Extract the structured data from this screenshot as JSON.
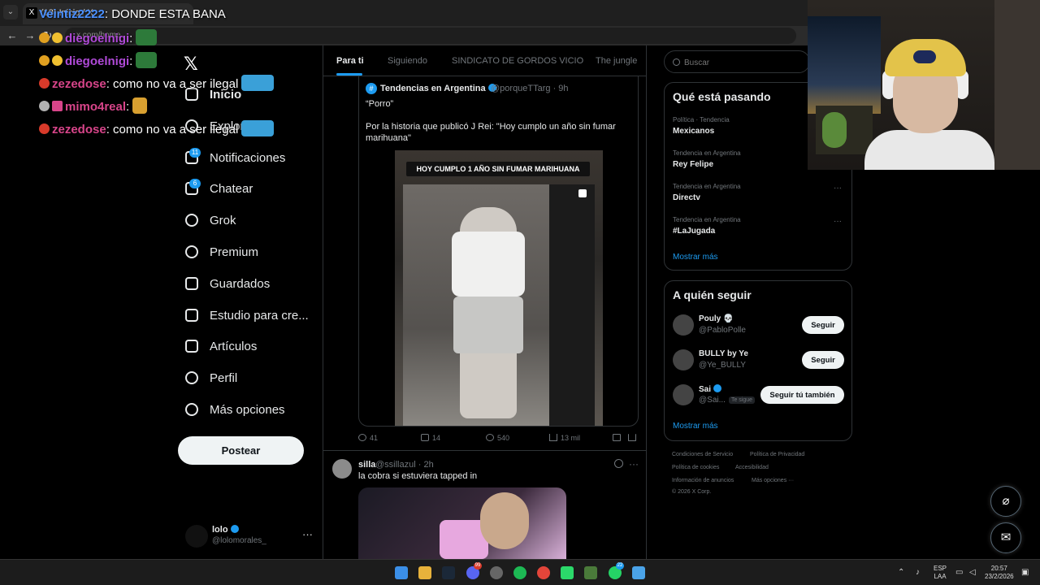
{
  "browser": {
    "tab_title": "(13) Inicio / X",
    "tab_menu_glyph": "⌄",
    "url_text": "x.com/home"
  },
  "chat": [
    {
      "user": "Veintiz2222",
      "message": ": DONDE ESTA BANA",
      "user_color": "#4a90ff"
    },
    {
      "user": "diegoelnigi",
      "message": ":",
      "user_color": "#b04ad8"
    },
    {
      "user": "diegoelnigi",
      "message": ":",
      "user_color": "#b04ad8"
    },
    {
      "user": "zezedose",
      "message": ": como no va a ser ilegal",
      "user_color": "#d8458a"
    },
    {
      "user": "mimo4real",
      "message": ":",
      "user_color": "#d8458a"
    },
    {
      "user": "zezedose",
      "message": ": como no va a ser ilegal",
      "user_color": "#d8458a"
    }
  ],
  "nav": {
    "logo": "𝕏",
    "items": [
      {
        "label": "Inicio"
      },
      {
        "label": "Explorar"
      },
      {
        "label": "Notificaciones",
        "badge": "11"
      },
      {
        "label": "Chatear",
        "badge": "6"
      },
      {
        "label": "Grok"
      },
      {
        "label": "Premium"
      },
      {
        "label": "Guardados"
      },
      {
        "label": "Estudio para cre..."
      },
      {
        "label": "Artículos"
      },
      {
        "label": "Perfil"
      },
      {
        "label": "Más opciones"
      }
    ],
    "post_button": "Postear",
    "account": {
      "name": "lolo",
      "handle": "@lolomorales_",
      "more": "···"
    }
  },
  "feed": {
    "tabs": [
      "Para ti",
      "Siguiendo",
      "SINDICATO DE GORDOS VICIO",
      "The jungle"
    ],
    "quoted": {
      "avatar_glyph": "#",
      "name": "Tendencias en Argentina",
      "handle": "@porqueTTarg · 9h",
      "text1": "“Porro”",
      "text2": "Por la historia que publicó J Rei: \"Hoy cumplo un año sin fumar marihuana\"",
      "media_caption": "HOY CUMPLO 1 AÑO SIN FUMAR MARIHUANA"
    },
    "actions": {
      "replies": "41",
      "reposts": "14",
      "likes": "540",
      "views": "13 mil"
    },
    "post2": {
      "name": "silla",
      "handle": "@ssillazul · 2h",
      "text": "la cobra si estuviera tapped in",
      "more": "···"
    }
  },
  "search": {
    "placeholder": "Buscar"
  },
  "trends": {
    "title": "Qué está pasando",
    "items": [
      {
        "meta": "Política · Tendencia",
        "name": "Mexicanos"
      },
      {
        "meta": "Tendencia en Argentina",
        "name": "Rey Felipe"
      },
      {
        "meta": "Tendencia en Argentina",
        "name": "Directv"
      },
      {
        "meta": "Tendencia en Argentina",
        "name": "#LaJugada"
      }
    ],
    "more_glyph": "···",
    "show_more": "Mostrar más"
  },
  "who_to_follow": {
    "title": "A quién seguir",
    "items": [
      {
        "name": "Pouly 💀",
        "handle": "@PabloPolle",
        "button": "Seguir"
      },
      {
        "name": "BULLY by Ye",
        "handle": "@Ye_BULLY",
        "button": "Seguir"
      },
      {
        "name": "Sai",
        "handle": "@Sai...",
        "follows_you": "Te sigue",
        "button": "Seguir tú también"
      }
    ],
    "show_more": "Mostrar más"
  },
  "footer": {
    "links": [
      "Condiciones de Servicio",
      "Política de Privacidad",
      "Política de cookies",
      "Accesibilidad",
      "Información de anuncios",
      "Más opciones ···",
      "© 2026 X Corp."
    ]
  },
  "fabs": {
    "grok_glyph": "⌀",
    "messages_glyph": "✉"
  },
  "taskbar": {
    "language": "ESP",
    "layout": "LAA",
    "time": "20:57",
    "date": "23/2/2026",
    "badges": {
      "discord": "99",
      "whatsapp": "22"
    }
  },
  "colors": {
    "accent": "#1d9bf0",
    "background": "#000000",
    "border": "#2f3336",
    "muted": "#71767b"
  }
}
